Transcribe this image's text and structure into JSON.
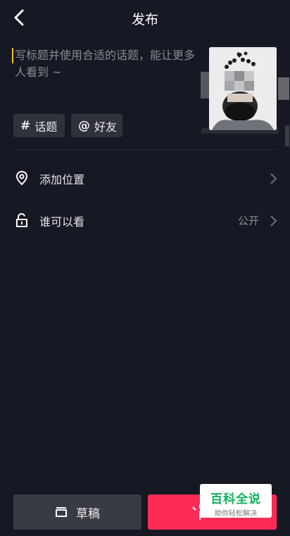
{
  "header": {
    "back_icon": "chevron-left-icon",
    "title": "发布"
  },
  "caption": {
    "placeholder": "写标题并使用合适的话题，能让更多人看到 ~"
  },
  "tags": {
    "topic": {
      "icon": "hash-icon",
      "symbol": "#",
      "label": "话题"
    },
    "friend": {
      "icon": "at-icon",
      "symbol": "@",
      "label": "好友"
    }
  },
  "settings": {
    "location": {
      "icon": "location-pin-icon",
      "label": "添加位置"
    },
    "visibility": {
      "icon": "unlock-icon",
      "label": "谁可以看",
      "value": "公开"
    }
  },
  "footer": {
    "draft": {
      "icon": "draft-box-icon",
      "label": "草稿"
    },
    "publish": {
      "icon": "sparkle-icon",
      "label": ""
    }
  },
  "watermark": {
    "main": "百科全说",
    "sub": "助你轻松解决"
  },
  "colors": {
    "background": "#161823",
    "accent": "#fe2c55",
    "cursor": "#f7c23b",
    "watermark_green": "#0fb05a"
  }
}
